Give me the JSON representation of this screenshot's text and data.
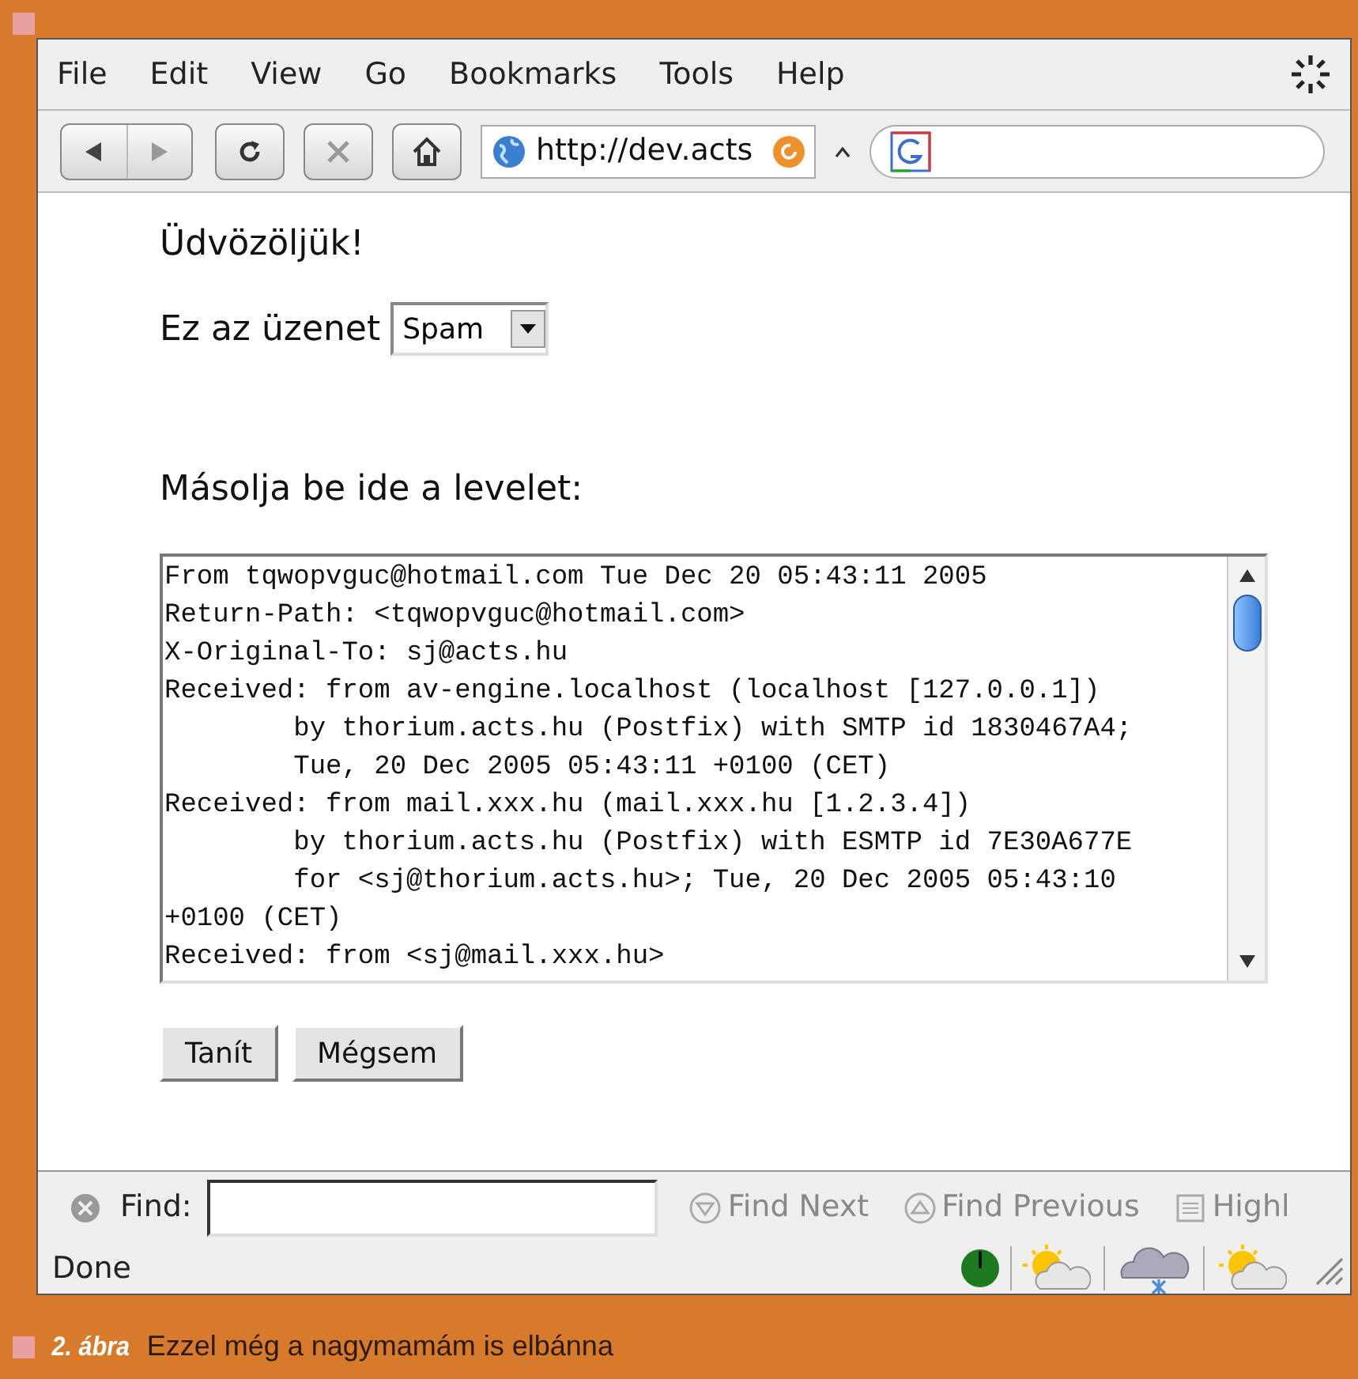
{
  "menu": [
    "File",
    "Edit",
    "View",
    "Go",
    "Bookmarks",
    "Tools",
    "Help"
  ],
  "toolbar": {
    "url": "http://dev.acts"
  },
  "page": {
    "greeting": "Üdvözöljük!",
    "message_label": "Ez az üzenet",
    "message_type": "Spam",
    "paste_label": "Másolja be ide a levelet:",
    "mail_lines": [
      "From tqwopvguc@hotmail.com Tue Dec 20 05:43:11 2005",
      "Return-Path: <tqwopvguc@hotmail.com>",
      "X-Original-To: sj@acts.hu",
      "Received: from av-engine.localhost (localhost [127.0.0.1])",
      "        by thorium.acts.hu (Postfix) with SMTP id 1830467A4;",
      "        Tue, 20 Dec 2005 05:43:11 +0100 (CET)",
      "Received: from mail.xxx.hu (mail.xxx.hu [1.2.3.4])",
      "        by thorium.acts.hu (Postfix) with ESMTP id 7E30A677E",
      "        for <sj@thorium.acts.hu>; Tue, 20 Dec 2005 05:43:10",
      "+0100 (CET)",
      "Received: from <sj@mail.xxx.hu>"
    ],
    "buttons": [
      "Tanít",
      "Mégsem"
    ]
  },
  "find_bar": {
    "label": "Find:",
    "buttons": [
      "Find Next",
      "Find Previous",
      "Highl"
    ]
  },
  "status_bar": {
    "text": "Done"
  },
  "caption": {
    "number": "2. ábra",
    "text": "Ezzel még a nagymamám is elbánna"
  }
}
